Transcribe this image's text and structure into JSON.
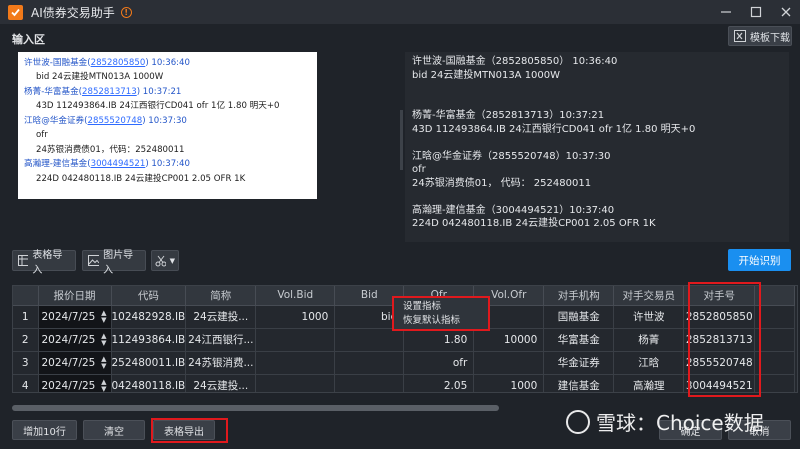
{
  "window": {
    "title": "AI债券交易助手"
  },
  "input_area": {
    "label": "输入区",
    "template_download": "模板下载",
    "chat_lines": [
      {
        "name": "许世波-国融基金(",
        "id": "2852805850",
        "tail": ")  10:36:40",
        "msg": "bid 24云建投MTN013A 1000W"
      },
      {
        "name": "杨菁-华富基金(",
        "id": "2852813713",
        "tail": ")  10:37:21",
        "msg": "43D 112493864.IB 24江西银行CD041 ofr 1亿 1.80 明天+0"
      },
      {
        "name": "江晗@华金证券(",
        "id": "2855520748",
        "tail": ")  10:37:30",
        "msg": "ofr",
        "msg2": "24苏银消费债01，代码：252480011"
      },
      {
        "name": "高瀚理-建信基金(",
        "id": "3004494521",
        "tail": ")  10:37:40",
        "msg": "224D  042480118.IB  24云建投CP001  2.05 OFR 1K"
      }
    ],
    "plain_text": [
      "许世波-国融基金（2852805850）  10:36:40",
      "bid  24云建投MTN013A  1000W",
      "",
      "杨菁-华富基金（2852813713）10:37:21",
      "43D  112493864.IB  24江西银行CD041  ofr  1亿  1.80  明天+0",
      "",
      "江晗@华金证券（2855520748）10:37:30",
      "ofr",
      "24苏银消费债01，   代码：   252480011",
      "",
      "高瀚理-建信基金（3004494521）10:37:40",
      "224D  042480118.IB  24云建投CP001  2.05  OFR  1K"
    ]
  },
  "toolbar": {
    "table_import": "表格导入",
    "image_import": "图片导入",
    "start": "开始识别"
  },
  "grid": {
    "headers": [
      "",
      "报价日期",
      "代码",
      "简称",
      "Vol.Bid",
      "Bid",
      "Ofr",
      "Vol.Ofr",
      "对手机构",
      "对手交易员",
      "对手号",
      ""
    ],
    "rows": [
      [
        "1",
        "2024/7/25",
        "102482928.IB",
        "24云建投...",
        "1000",
        "bid",
        "",
        "",
        "国融基金",
        "许世波",
        "2852805850",
        ""
      ],
      [
        "2",
        "2024/7/25",
        "112493864.IB",
        "24江西银行...",
        "",
        "",
        "1.80",
        "10000",
        "华富基金",
        "杨菁",
        "2852813713",
        ""
      ],
      [
        "3",
        "2024/7/25",
        "252480011.IB",
        "24苏银消费...",
        "",
        "",
        "ofr",
        "",
        "华金证券",
        "江晗",
        "2855520748",
        ""
      ],
      [
        "4",
        "2024/7/25",
        "042480118.IB",
        "24云建投...",
        "",
        "",
        "2.05",
        "1000",
        "建信基金",
        "高瀚理",
        "3004494521",
        ""
      ]
    ]
  },
  "context_menu": {
    "items": [
      "设置指标",
      "恢复默认指标"
    ]
  },
  "bottom": {
    "add10": "增加10行",
    "clear": "清空",
    "export": "表格导出",
    "confirm": "确定",
    "cancel": "取消"
  },
  "watermark": {
    "text": "雪球：Choice数据"
  },
  "colors": {
    "accent": "#1a8ff0",
    "highlight": "#e0191d",
    "brand": "#f27a1a"
  }
}
